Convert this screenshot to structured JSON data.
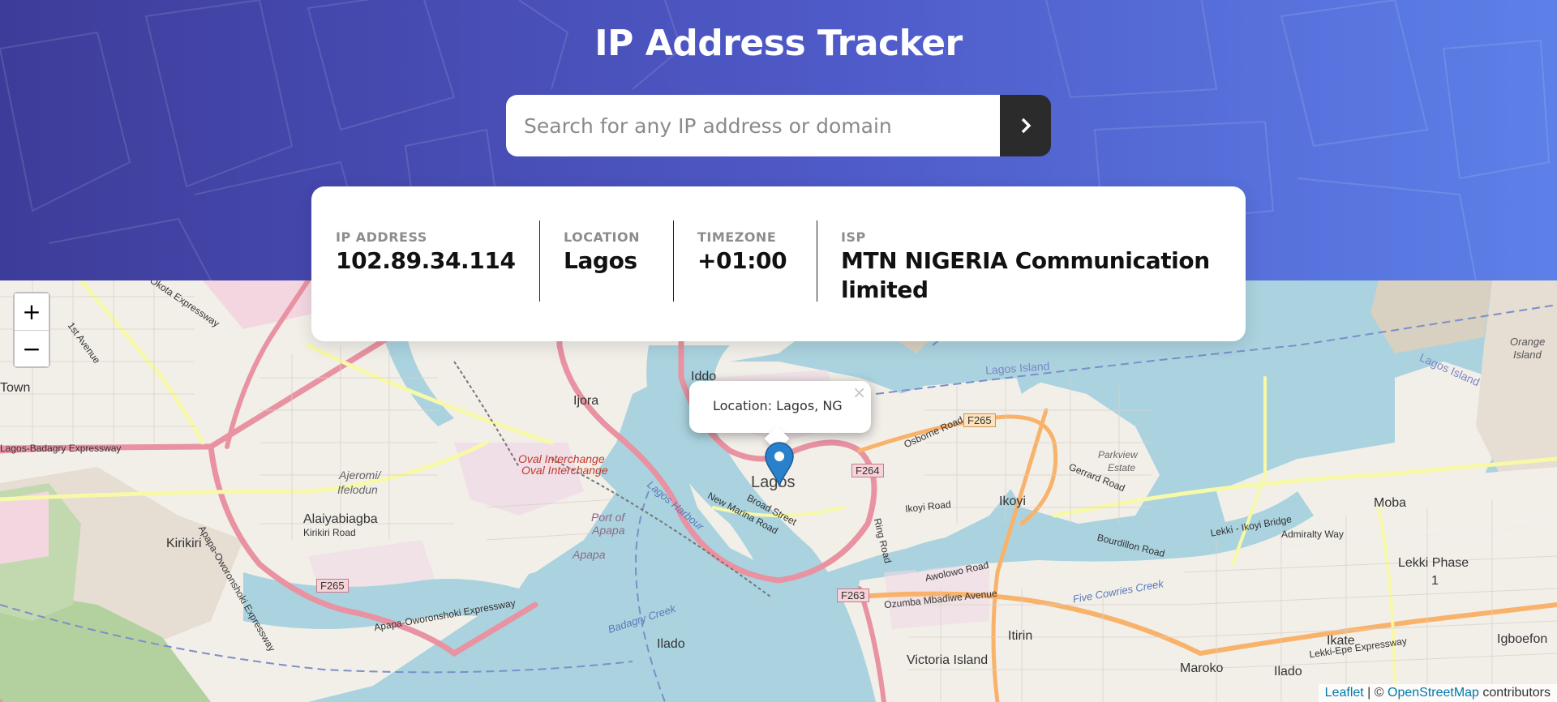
{
  "app": {
    "title": "IP Address Tracker"
  },
  "search": {
    "placeholder": "Search for any IP address or domain"
  },
  "stats": [
    {
      "label": "IP ADDRESS",
      "value": "102.89.34.114"
    },
    {
      "label": "LOCATION",
      "value": "Lagos"
    },
    {
      "label": "TIMEZONE",
      "value": "+01:00"
    },
    {
      "label": "ISP",
      "value": "MTN NIGERIA Communication limited"
    }
  ],
  "map": {
    "zoom_in": "+",
    "zoom_out": "−",
    "popup": {
      "text": "Location: Lagos, NG",
      "close": "×"
    },
    "attribution": {
      "leaflet": "Leaflet",
      "sep": " | © ",
      "osm": "OpenStreetMap",
      "suffix": " contributors"
    },
    "labels": {
      "lagos": "Lagos",
      "iddo": "Iddo",
      "ijora": "Ijora",
      "ikoyi": "Ikoyi",
      "lagos_island": "Lagos Island",
      "lagos_island_2": "Lagos Island",
      "victoria_island": "Victoria Island",
      "maroko": "Maroko",
      "ilado": "Ilado",
      "ilado_2": "Ilado",
      "moba": "Moba",
      "lekki_phase": "Lekki Phase",
      "lekki_phase_num": "1",
      "kirikiri": "Kirikiri",
      "alaiyabiagba": "Alaiyabiagba",
      "ajeromi": "Ajeromi/",
      "ifelodun": "Ifelodun",
      "itirin": "Itirin",
      "igboefon": "Igboefon",
      "ikate": "Ikate",
      "town": "Town",
      "orange_island": "Orange",
      "orange_island_2": "Island",
      "oval_1": "Oval Interchange",
      "oval_2": "Oval Interchange",
      "port_apapa_1": "Port of",
      "port_apapa_2": "Apapa",
      "apapa": "Apapa",
      "parkview_1": "Parkview",
      "parkview_2": "Estate",
      "broad_street": "Broad Street",
      "new_marina": "New Marina Road",
      "badagry_exp": "Lagos-Badagry Expressway",
      "apapa_exp": "Apapa-Oworonshoki Expressway",
      "apapa_exp2": "Apapa-Oworonshoki Expressway",
      "ozumba": "Ozumba Mbadiwe Avenue",
      "lekki_epe": "Lekki-Epe Expressway",
      "five_cowries": "Five Cowries Creek",
      "osborne": "Osborne Road",
      "gerrard": "Gerrard Road",
      "bourdillon": "Bourdillon Road",
      "awolowo": "Awolowo Road",
      "admiralty": "Admiralty Way",
      "lekki_bridge": "Lekki - Ikoyi Bridge",
      "lagos_harbour": "Lagos Harbour",
      "badagry_creek": "Badagry Creek",
      "ikoyi_road": "Ikoyi Road",
      "kirikiri_road": "Kirikiri Road",
      "f265": "F265",
      "f264": "F264",
      "f263": "F263",
      "f265b": "F265",
      "ring_road": "Ring Road",
      "first_avenue": "1st Avenue",
      "ojo": "Go Okota Expressway"
    }
  },
  "colors": {
    "accent_dark": "#2b2b2b",
    "header_start": "#3e3c9a",
    "header_end": "#5d80e8",
    "marker": "#2a81cb"
  }
}
